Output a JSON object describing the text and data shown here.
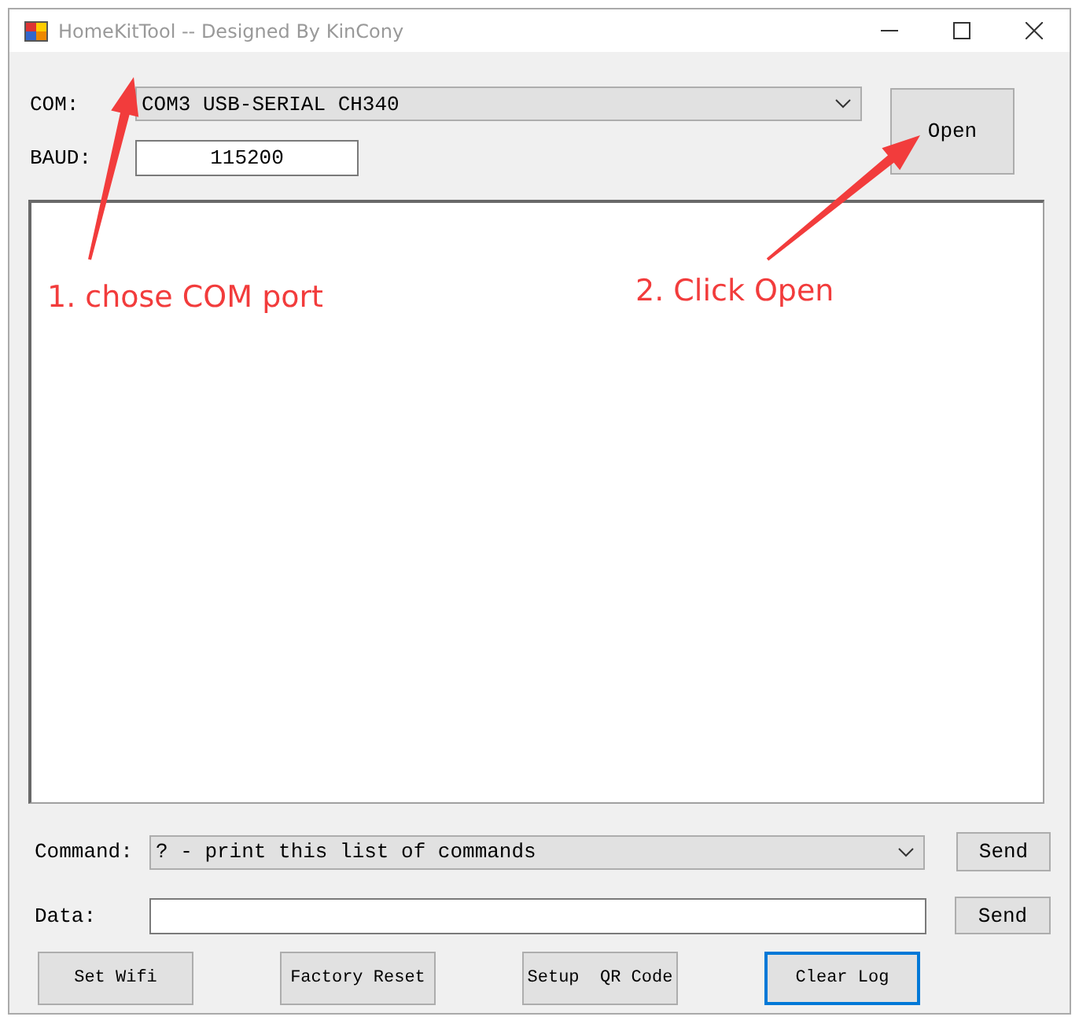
{
  "window": {
    "title": "HomeKitTool -- Designed By KinCony"
  },
  "com": {
    "label": "COM:",
    "value": "COM3 USB-SERIAL CH340"
  },
  "baud": {
    "label": "BAUD:",
    "value": "115200"
  },
  "open_button": {
    "label": "Open"
  },
  "command": {
    "label": "Command:",
    "value": "? - print this list of commands",
    "button": "Send"
  },
  "data": {
    "label": "Data:",
    "button": "Send"
  },
  "buttons": [
    {
      "label": "Set Wifi",
      "focused": false
    },
    {
      "label": "Factory Reset",
      "focused": false
    },
    {
      "label": "Setup  QR Code",
      "focused": false
    },
    {
      "label": "Clear Log",
      "focused": true
    }
  ],
  "annotations": [
    {
      "text": "1. chose COM port"
    },
    {
      "text": "2. Click Open"
    }
  ]
}
